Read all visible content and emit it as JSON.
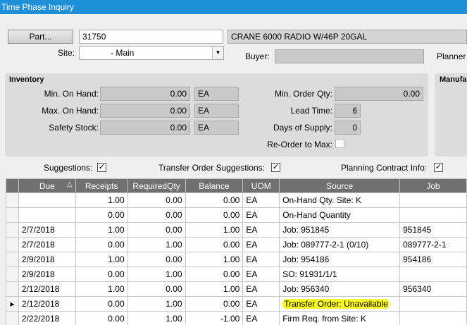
{
  "window": {
    "title": "Time Phase Inquiry"
  },
  "header": {
    "part_button": "Part...",
    "part_value": "31750",
    "part_description": "CRANE 6000 RADIO W/46P 20GAL",
    "site_label": "Site:",
    "site_value": "- Main",
    "buyer_label": "Buyer:",
    "buyer_value": "",
    "planner_label": "Planner"
  },
  "inventory": {
    "title": "Inventory",
    "min_on_hand_label": "Min. On Hand:",
    "min_on_hand_value": "0.00",
    "min_on_hand_uom": "EA",
    "max_on_hand_label": "Max. On Hand:",
    "max_on_hand_value": "0.00",
    "max_on_hand_uom": "EA",
    "safety_stock_label": "Safety Stock:",
    "safety_stock_value": "0.00",
    "safety_stock_uom": "EA",
    "min_order_qty_label": "Min. Order Qty:",
    "min_order_qty_value": "0.00",
    "lead_time_label": "Lead Time:",
    "lead_time_value": "6",
    "days_supply_label": "Days of Supply:",
    "days_supply_value": "0",
    "reorder_max_label": "Re-Order to Max:",
    "reorder_max_checked": false
  },
  "manufacturing": {
    "title": "Manufa"
  },
  "options": {
    "suggestions_label": "Suggestions:",
    "suggestions_checked": true,
    "transfer_label": "Transfer Order Suggestions:",
    "transfer_checked": true,
    "planning_label": "Planning Contract Info:",
    "planning_checked": true
  },
  "grid": {
    "columns": [
      "Due",
      "Receipts",
      "RequiredQty",
      "Balance",
      "UOM",
      "Source",
      "Job"
    ],
    "sort_indicator": "△",
    "rows": [
      {
        "due": "",
        "receipts": "1.00",
        "required": "0.00",
        "balance": "0.00",
        "uom": "EA",
        "source": "On-Hand Qty. Site: K",
        "job": ""
      },
      {
        "due": "",
        "receipts": "0.00",
        "required": "0.00",
        "balance": "0.00",
        "uom": "EA",
        "source": "On-Hand Quantity",
        "job": ""
      },
      {
        "due": "2/7/2018",
        "receipts": "1.00",
        "required": "0.00",
        "balance": "1.00",
        "uom": "EA",
        "source": "Job: 951845",
        "job": "951845"
      },
      {
        "due": "2/7/2018",
        "receipts": "0.00",
        "required": "1.00",
        "balance": "0.00",
        "uom": "EA",
        "source": "Job: 089777-2-1 (0/10)",
        "job": "089777-2-1"
      },
      {
        "due": "2/9/2018",
        "receipts": "1.00",
        "required": "0.00",
        "balance": "1.00",
        "uom": "EA",
        "source": "Job: 954186",
        "job": "954186"
      },
      {
        "due": "2/9/2018",
        "receipts": "0.00",
        "required": "1.00",
        "balance": "0.00",
        "uom": "EA",
        "source": "SO: 91931/1/1",
        "job": ""
      },
      {
        "due": "2/12/2018",
        "receipts": "1.00",
        "required": "0.00",
        "balance": "1.00",
        "uom": "EA",
        "source": "Job: 956340",
        "job": "956340"
      },
      {
        "due": "2/12/2018",
        "receipts": "0.00",
        "required": "1.00",
        "balance": "0.00",
        "uom": "EA",
        "source": "Transfer Order: Unavailable",
        "job": ""
      },
      {
        "due": "2/22/2018",
        "receipts": "0.00",
        "required": "1.00",
        "balance": "-1.00",
        "uom": "EA",
        "source": "Firm Req. from Site: K",
        "job": ""
      }
    ],
    "current_row_indicator": "▸"
  },
  "colors": {
    "title_bar": "#1e90d8",
    "highlight": "#ffff2a",
    "grid_header": "#707070"
  }
}
